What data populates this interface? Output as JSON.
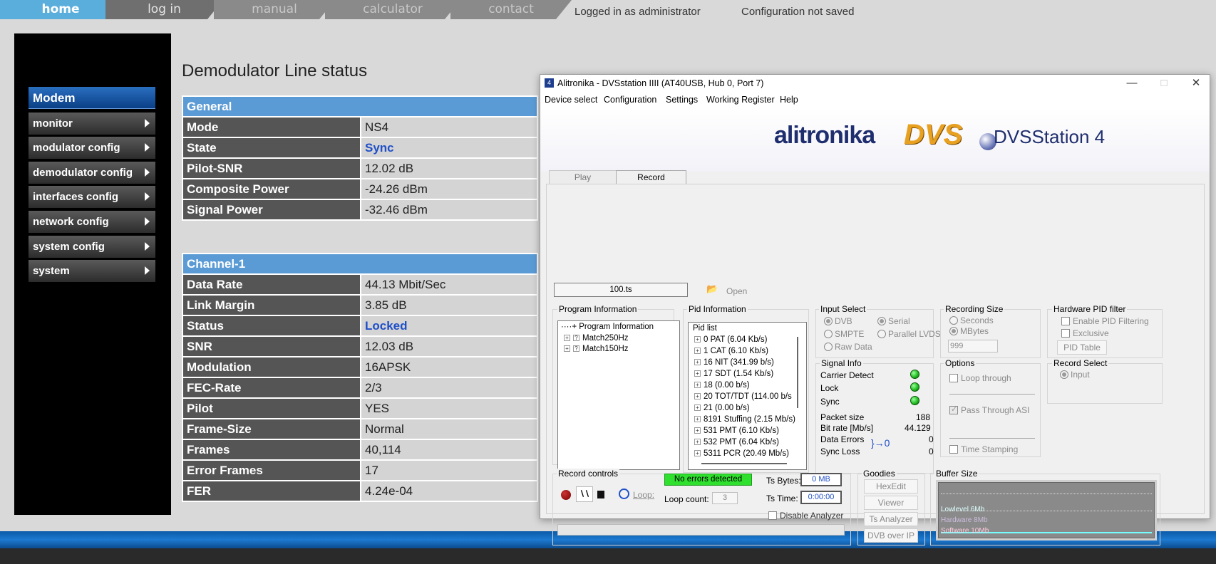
{
  "nav": {
    "tabs": [
      "home",
      "log in",
      "manual",
      "calculator",
      "contact"
    ],
    "logged_in": "Logged in as administrator",
    "config_status": "Configuration not saved"
  },
  "sidebar": {
    "heading": "Modem",
    "items": [
      "monitor",
      "modulator config",
      "demodulator config",
      "interfaces config",
      "network config",
      "system config",
      "system"
    ]
  },
  "page": {
    "title": "Demodulator Line status",
    "general": {
      "heading": "General",
      "rows": [
        {
          "k": "Mode",
          "v": "NS4"
        },
        {
          "k": "State",
          "v": "Sync"
        },
        {
          "k": "Pilot-SNR",
          "v": "12.02 dB"
        },
        {
          "k": "Composite Power",
          "v": "-24.26 dBm"
        },
        {
          "k": "Signal Power",
          "v": "-32.46 dBm"
        }
      ]
    },
    "channel": {
      "heading": "Channel-1",
      "rows": [
        {
          "k": "Data Rate",
          "v": "44.13 Mbit/Sec"
        },
        {
          "k": "Link Margin",
          "v": "3.85 dB"
        },
        {
          "k": "Status",
          "v": "Locked"
        },
        {
          "k": "SNR",
          "v": "12.03 dB"
        },
        {
          "k": "Modulation",
          "v": "16APSK"
        },
        {
          "k": "FEC-Rate",
          "v": "2/3"
        },
        {
          "k": "Pilot",
          "v": "YES"
        },
        {
          "k": "Frame-Size",
          "v": "Normal"
        },
        {
          "k": "Frames",
          "v": "40,114"
        },
        {
          "k": "Error Frames",
          "v": "17"
        },
        {
          "k": "FER",
          "v": "4.24e-04"
        }
      ]
    }
  },
  "window": {
    "title": "Alitronika - DVSstation IIII  (AT40USB, Hub 0, Port 7)",
    "icon_text": "4",
    "menu": [
      "Device select",
      "Configuration",
      "Settings",
      "Working Register",
      "Help"
    ],
    "logo_main": "alitronika",
    "logo_dvs": "DVS",
    "logo_station": "DVSStation 4",
    "tabs": [
      "Play",
      "Record"
    ],
    "file_name": "100.ts",
    "open_label": "Open",
    "program_info": {
      "title": "Program Information",
      "root": "Program Information",
      "items": [
        "Match250Hz",
        "Match150Hz"
      ]
    },
    "pid_info": {
      "title": "Pid Information",
      "header": "Pid list",
      "items": [
        "0 PAT (6.04 Kb/s)",
        "1 CAT (6.10 Kb/s)",
        "16 NIT (341.99 b/s)",
        "17 SDT (1.54 Kb/s)",
        "18  (0.00 b/s)",
        "20 TOT/TDT (114.00 b/s",
        "21  (0.00 b/s)",
        "8191 Stuffing (2.15 Mb/s)",
        "531 PMT (6.10 Kb/s)",
        "532 PMT (6.04 Kb/s)",
        "5311 PCR (20.49 Mb/s)"
      ]
    },
    "input_select": {
      "title": "Input Select",
      "options": [
        "DVB",
        "Serial",
        "SMPTE",
        "Parallel LVDS",
        "Raw Data"
      ]
    },
    "signal_info": {
      "title": "Signal Info",
      "carrier": "Carrier Detect",
      "lock": "Lock",
      "sync": "Sync",
      "packet_label": "Packet size",
      "packet_value": "188",
      "bitrate_label": "Bit rate [Mb/s]",
      "bitrate_value": "44.129",
      "data_errors_label": "Data Errors",
      "data_errors_value": "0",
      "sync_loss_label": "Sync Loss",
      "sync_loss_value": "0",
      "reset_symbol": "}→0"
    },
    "recording_size": {
      "title": "Recording Size",
      "options": [
        "Seconds",
        "MBytes"
      ],
      "value": "999"
    },
    "hw_pid": {
      "title": "Hardware PID filter",
      "enable": "Enable PID Filtering",
      "exclusive": "Exclusive",
      "table_btn": "PID Table"
    },
    "options": {
      "title": "Options",
      "loop": "Loop through",
      "pass": "Pass Through ASI",
      "timestamp": "Time Stamping"
    },
    "record_select": {
      "title": "Record Select",
      "input": "Input"
    },
    "record_controls": {
      "title": "Record controls",
      "loop_label": "Loop:",
      "status": "No errors detected",
      "loop_count_label": "Loop count:",
      "loop_count_value": "3",
      "ts_bytes_label": "Ts Bytes:",
      "ts_bytes_value": "0 MB",
      "ts_time_label": "Ts Time:",
      "ts_time_value": "0:00:00",
      "disable_analyzer": "Disable Analyzer"
    },
    "goodies": {
      "title": "Goodies",
      "buttons": [
        "HexEdit",
        "Viewer",
        "Ts Analyzer",
        "DVB over IP"
      ]
    },
    "buffer": {
      "title": "Buffer Size",
      "lines": [
        "Lowlevel 6Mb",
        "Hardware 8Mb",
        "Software 10Mb"
      ]
    }
  }
}
